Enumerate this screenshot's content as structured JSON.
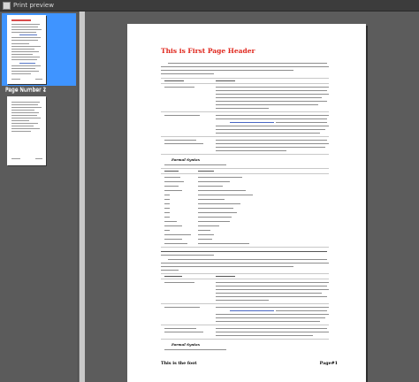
{
  "window": {
    "title": "Print preview"
  },
  "thumbnails": [
    {
      "label": "Page Number 1",
      "selected": true
    },
    {
      "label": "Page Number 2",
      "selected": false
    }
  ],
  "page": {
    "header": "This is First Page Header",
    "section_titles": [
      "Formal Syntax",
      "Formal Syntax"
    ],
    "footer": "This is the foot",
    "page_number": "Page#1"
  }
}
